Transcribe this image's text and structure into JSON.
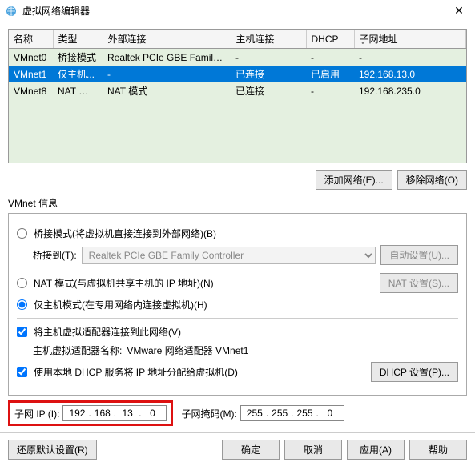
{
  "window": {
    "title": "虚拟网络编辑器"
  },
  "table": {
    "headers": [
      "名称",
      "类型",
      "外部连接",
      "主机连接",
      "DHCP",
      "子网地址"
    ],
    "rows": [
      {
        "cells": [
          "VMnet0",
          "桥接模式",
          "Realtek PCIe GBE Family Co...",
          "-",
          "-",
          "-"
        ],
        "selected": false
      },
      {
        "cells": [
          "VMnet1",
          "仅主机...",
          "-",
          "已连接",
          "已启用",
          "192.168.13.0"
        ],
        "selected": true
      },
      {
        "cells": [
          "VMnet8",
          "NAT 模式",
          "NAT 模式",
          "已连接",
          "-",
          "192.168.235.0"
        ],
        "selected": false
      }
    ]
  },
  "buttons": {
    "add_network": "添加网络(E)...",
    "remove_network": "移除网络(O)",
    "auto_settings": "自动设置(U)...",
    "nat_settings": "NAT 设置(S)...",
    "dhcp_settings": "DHCP 设置(P)...",
    "restore_defaults": "还原默认设置(R)",
    "ok": "确定",
    "cancel": "取消",
    "apply": "应用(A)",
    "help": "帮助"
  },
  "group": {
    "title": "VMnet 信息",
    "radio_bridged": "桥接模式(将虚拟机直接连接到外部网络)(B)",
    "bridged_to_label": "桥接到(T):",
    "bridged_to_value": "Realtek PCIe GBE Family Controller",
    "radio_nat": "NAT 模式(与虚拟机共享主机的 IP 地址)(N)",
    "radio_hostonly": "仅主机模式(在专用网络内连接虚拟机)(H)",
    "check_host_adapter": "将主机虚拟适配器连接到此网络(V)",
    "host_adapter_label": "主机虚拟适配器名称:",
    "host_adapter_value": "VMware 网络适配器 VMnet1",
    "check_dhcp": "使用本地 DHCP 服务将 IP 地址分配给虚拟机(D)"
  },
  "ip": {
    "subnet_label": "子网 IP (I):",
    "subnet_octets": [
      "192",
      "168",
      "13",
      "0"
    ],
    "mask_label": "子网掩码(M):",
    "mask_octets": [
      "255",
      "255",
      "255",
      "0"
    ]
  }
}
